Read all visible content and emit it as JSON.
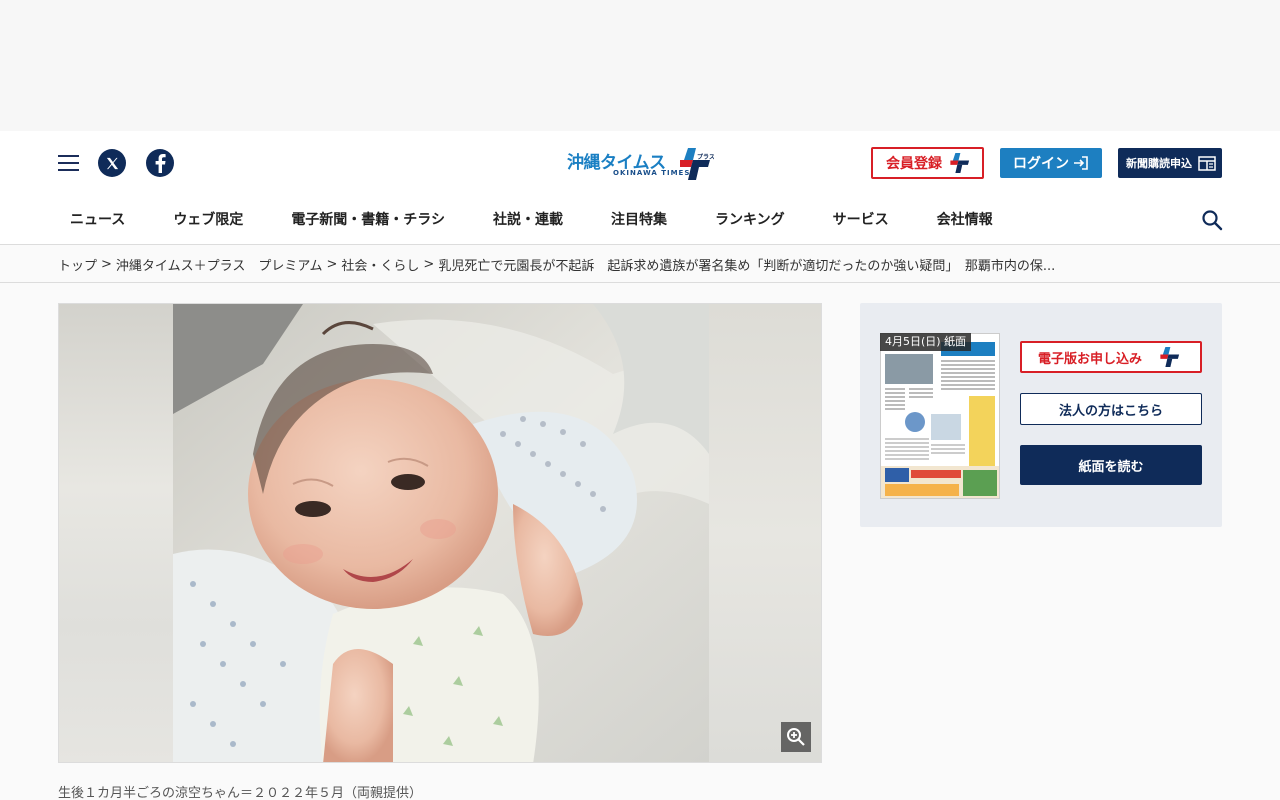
{
  "header": {
    "logo_text": "沖縄タイムス",
    "logo_sub": "OKINAWA TIMES",
    "logo_plus_text": "プラス",
    "register_label": "会員登録",
    "login_label": "ログイン",
    "subscribe_label": "新聞購読申込",
    "brand_colors": {
      "navy": "#0f2b59",
      "blue": "#1d7fc1",
      "red": "#d81f26"
    }
  },
  "nav": {
    "items": [
      "ニュース",
      "ウェブ限定",
      "電子新聞・書籍・チラシ",
      "社説・連載",
      "注目特集",
      "ランキング",
      "サービス",
      "会社情報"
    ]
  },
  "breadcrumb": {
    "items": [
      "トップ",
      "沖縄タイムス＋プラス　プレミアム",
      "社会・くらし",
      "乳児死亡で元園長が不起訴　起訴求め遺族が署名集め「判断が適切だったのか強い疑問」　那覇市内の保..."
    ],
    "separator": ">"
  },
  "photo": {
    "caption": "生後１カ月半ごろの涼空ちゃん＝２０２２年５月（両親提供）"
  },
  "paper": {
    "date_label": "4月5日(日) 紙面",
    "digital_label": "電子版お申し込み",
    "corp_label": "法人の方はこちら",
    "read_label": "紙面を読む"
  },
  "icons": {
    "menu": "hamburger-icon",
    "x": "x-icon",
    "facebook": "facebook-icon",
    "search": "search-icon",
    "login": "login-arrow-icon",
    "newspaper": "newspaper-icon",
    "zoom": "zoom-in-icon"
  }
}
